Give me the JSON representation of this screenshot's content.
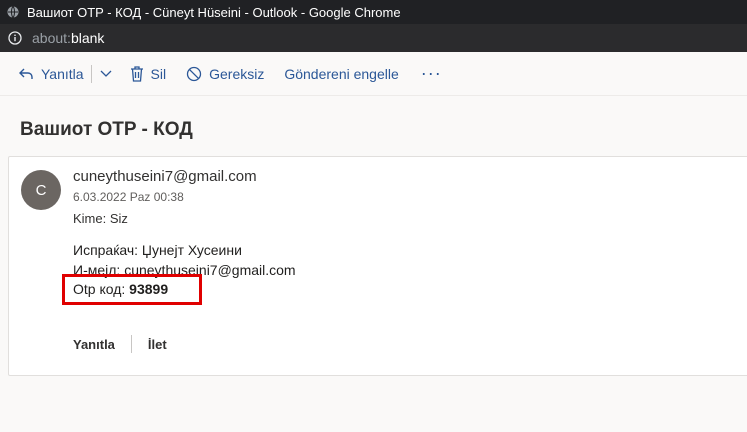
{
  "window": {
    "title": "Вашиот OTP - КОД - Cüneyt Hüseini - Outlook - Google Chrome",
    "url_scheme": "about:",
    "url_host": "blank"
  },
  "toolbar": {
    "reply_label": "Yanıtla",
    "delete_label": "Sil",
    "junk_label": "Gereksiz",
    "block_label": "Göndereni engelle",
    "more_label": "···"
  },
  "message": {
    "subject": "Вашиот OTP - КОД",
    "avatar_initial": "C",
    "sender_email": "cuneythuseini7@gmail.com",
    "date": "6.03.2022 Paz 00:38",
    "to_label": "Kime:",
    "to_value": "Siz",
    "body_sender_line": "Испраќач: Џунејт Хусеини",
    "body_email_line": "И-мејл: cuneythuseini7@gmail.com",
    "body_otp_label": "Otp код: ",
    "body_otp_code": "93899"
  },
  "actions": {
    "reply": "Yanıtla",
    "forward": "İlet"
  },
  "colors": {
    "accent": "#2b5797",
    "highlight_box": "#e00000",
    "avatar_bg": "#6b6662"
  }
}
